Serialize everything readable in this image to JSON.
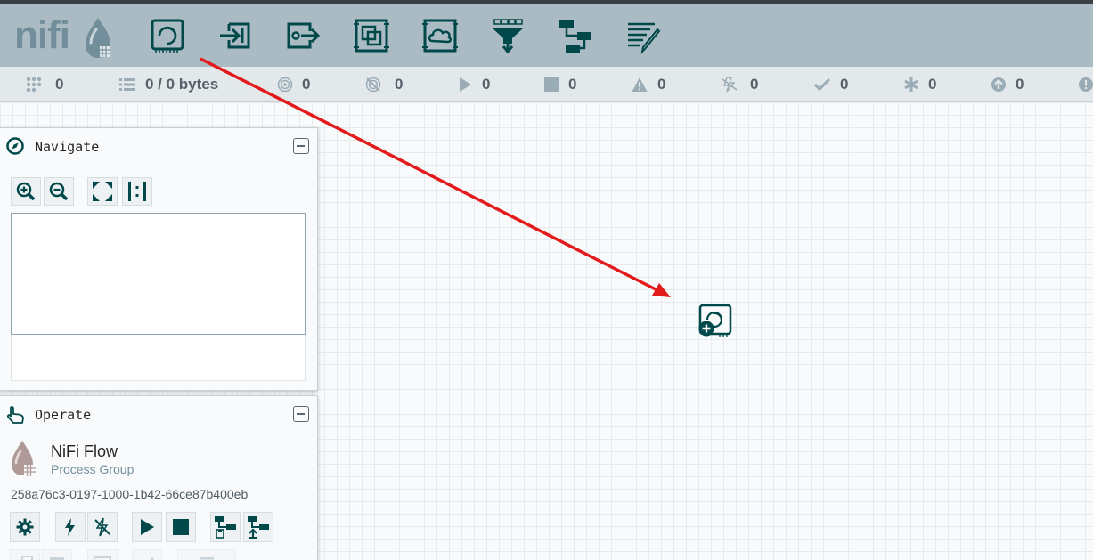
{
  "header": {
    "logo_text": "nifi",
    "toolbar": [
      {
        "name": "processor",
        "icon": "processor-icon"
      },
      {
        "name": "input-port",
        "icon": "input-port-icon"
      },
      {
        "name": "output-port",
        "icon": "output-port-icon"
      },
      {
        "name": "process-group",
        "icon": "process-group-icon"
      },
      {
        "name": "remote-process-group",
        "icon": "remote-process-group-icon"
      },
      {
        "name": "funnel",
        "icon": "funnel-icon"
      },
      {
        "name": "template",
        "icon": "template-icon"
      },
      {
        "name": "label",
        "icon": "label-icon"
      }
    ]
  },
  "status": {
    "active_threads": "0",
    "queued": "0 / 0 bytes",
    "transmitting": "0",
    "not_transmitting": "0",
    "running": "0",
    "stopped": "0",
    "invalid": "0",
    "disabled": "0",
    "up_to_date": "0",
    "locally_modified": "0",
    "stale": "0"
  },
  "navigate": {
    "title": "Navigate",
    "buttons": [
      "zoom-in",
      "zoom-out",
      "fit",
      "actual-size"
    ]
  },
  "operate": {
    "title": "Operate",
    "component_name": "NiFi Flow",
    "component_type": "Process Group",
    "component_id": "258a76c3-0197-1000-1b42-66ce87b400eb"
  },
  "colors": {
    "header_bg": "#aabbc3",
    "icon_dark": "#004849",
    "logo": "#728e9b",
    "drag_arrow": "#e31a1c"
  }
}
